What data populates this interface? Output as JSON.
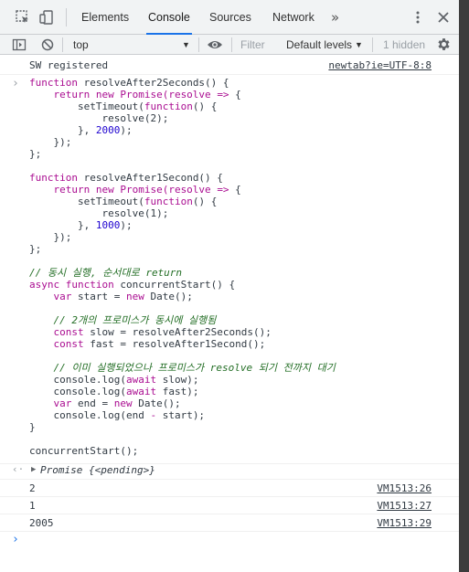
{
  "tabs": {
    "items": [
      "Elements",
      "Console",
      "Sources",
      "Network"
    ],
    "active": "Console",
    "more": "»"
  },
  "toolbar": {
    "context": "top",
    "filter_placeholder": "Filter",
    "levels": "Default levels",
    "hidden": "1 hidden"
  },
  "messages": {
    "sw_text": "SW registered",
    "sw_source": "newtab?ie=UTF-8:8",
    "promise_label": "Promise",
    "promise_state": "{<pending>}",
    "out1_value": "2",
    "out1_source": "VM1513:26",
    "out2_value": "1",
    "out2_source": "VM1513:27",
    "out3_value": "2005",
    "out3_source": "VM1513:29"
  },
  "code": {
    "l1a": "function",
    "l1b": " resolveAfter2Seconds() {",
    "l2a": "    return new Promise(resolve ",
    "l2b": "=>",
    "l2c": " {",
    "l3a": "        setTimeout(",
    "l3b": "function",
    "l3c": "() {",
    "l4": "            resolve(2);",
    "l5a": "        }, ",
    "l5b": "2000",
    "l5c": ");",
    "l6": "    });",
    "l7": "};",
    "l9a": "function",
    "l9b": " resolveAfter1Second() {",
    "l10a": "    return new Promise(resolve ",
    "l10b": "=>",
    "l10c": " {",
    "l11a": "        setTimeout(",
    "l11b": "function",
    "l11c": "() {",
    "l12": "            resolve(1);",
    "l13a": "        }, ",
    "l13b": "1000",
    "l13c": ");",
    "l14": "    });",
    "l15": "};",
    "l17": "// 동시 실행, 순서대로 return",
    "l18a": "async function",
    "l18b": " concurrentStart() {",
    "l19a": "    var",
    "l19b": " start = ",
    "l19c": "new",
    "l19d": " Date();",
    "l21": "    // 2개의 프로미스가 동시에 실행됨",
    "l22a": "    const",
    "l22b": " slow = resolveAfter2Seconds();",
    "l23a": "    const",
    "l23b": " fast = resolveAfter1Second();",
    "l25": "    // 이미 실행되었으나 프로미스가 resolve 되기 전까지 대기",
    "l26a": "    console.log(",
    "l26b": "await",
    "l26c": " slow);",
    "l27a": "    console.log(",
    "l27b": "await",
    "l27c": " fast);",
    "l28a": "    var",
    "l28b": " end = ",
    "l28c": "new",
    "l28d": " Date();",
    "l29a": "    console.log(end ",
    "l29b": "-",
    "l29c": " start);",
    "l30": "}",
    "l32": "concurrentStart();"
  }
}
